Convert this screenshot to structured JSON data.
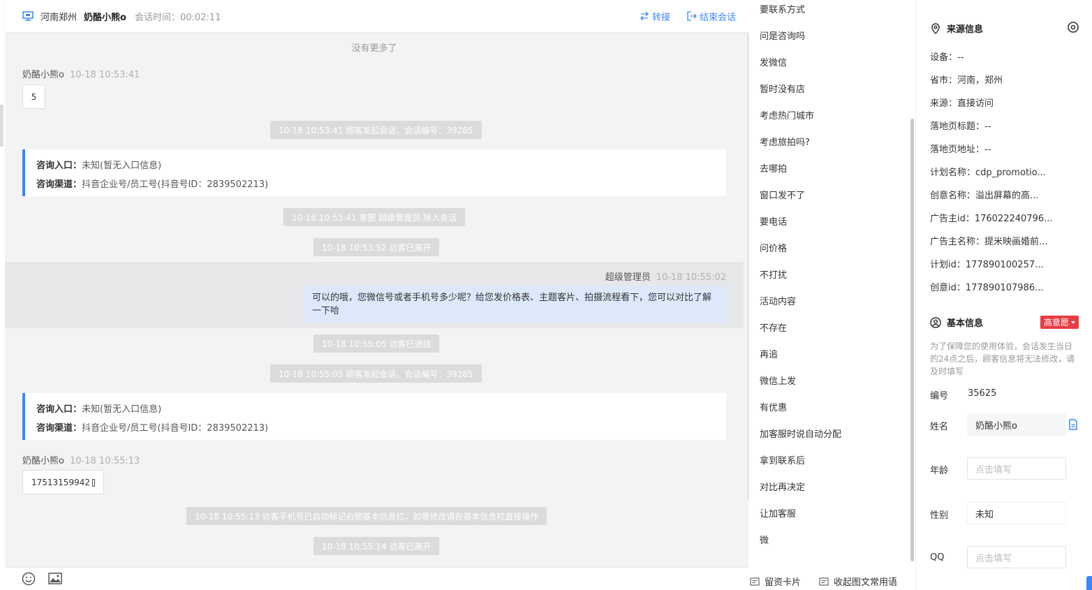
{
  "header": {
    "location": "河南郑州",
    "visitor_name": "奶酪小熊o",
    "session_time_label": "会话时间：",
    "session_time": "00:02:11",
    "transfer_label": "转接",
    "end_label": "结束会话"
  },
  "chat": {
    "no_more": "没有更多了",
    "msg1": {
      "sender": "奶酪小熊o",
      "time": "10-18 10:53:41",
      "text": "5"
    },
    "sys1": "10-18 10:53:41 顾客发起会话，会话编号：39285",
    "card1": {
      "entry_label": "咨询入口：",
      "entry_value": "未知(暂无入口信息)",
      "channel_label": "咨询渠道：",
      "channel_value": "抖音企业号/员工号(抖音号ID：2839502213)"
    },
    "sys2": "10-18 10:53:41 客服 超级管理员 接入会话",
    "sys3": "10-18 10:53:52 访客已离开",
    "agent_msg": {
      "sender": "超级管理员",
      "time": "10-18 10:55:02",
      "text": "可以的哦，您微信号或者手机号多少呢？给您发价格表、主题客片、拍摄流程看下，您可以对比了解一下哈"
    },
    "sys4": "10-18 10:55:05 访客已进线",
    "sys5": "10-18 10:55:05 顾客发起会话，会话编号：39285",
    "card2": {
      "entry_label": "咨询入口：",
      "entry_value": "未知(暂无入口信息)",
      "channel_label": "咨询渠道：",
      "channel_value": "抖音企业号/员工号(抖音号ID：2839502213)"
    },
    "msg2": {
      "sender": "奶酪小熊o",
      "time": "10-18 10:55:13",
      "text": "17513159942"
    },
    "sys6": "10-18 10:55:13 访客手机号已自动标记右侧基本信息栏，如需修改请在基本信息栏直接操作",
    "sys7": "10-18 10:55:14 访客已离开"
  },
  "phrases": {
    "items": [
      "要联系方式",
      "问是咨询吗",
      "发微信",
      "暂时没有店",
      "考虑热门城市",
      "考虑旅拍吗?",
      "去哪拍",
      "窗口发不了",
      "要电话",
      "问价格",
      "不打扰",
      "活动内容",
      "不存在",
      "再追",
      "微信上发",
      "有优惠",
      "加客服时说自动分配",
      "拿到联系后",
      "对比再决定",
      "让加客服",
      "微"
    ],
    "footer_card": "留资卡片",
    "footer_collapse": "收起图文常用语"
  },
  "source": {
    "title": "来源信息",
    "device": "设备：--",
    "province": "省市：河南，郑州",
    "origin": "来源：直接访问",
    "landing_title": "落地页标题：--",
    "landing_url": "落地页地址：--",
    "plan_name": "计划名称：cdp_promotio...",
    "creative_name": "创意名称：溢出屏幕的高...",
    "advertiser_id": "广告主id：176022240796...",
    "advertiser_name": "广告主名称：提米映画婚前...",
    "plan_id": "计划id：177890100257...",
    "creative_id": "创意id：177890107986..."
  },
  "basic": {
    "title": "基本信息",
    "intent_badge": "高意愿",
    "notice": "为了保障您的使用体验，会话发生当日的24点之后，顾客信息将无法修改，请及时填写",
    "id_label": "编号",
    "id_value": "35625",
    "name_label": "姓名",
    "name_value": "奶酪小熊o",
    "age_label": "年龄",
    "age_placeholder": "点击填写",
    "gender_label": "性别",
    "gender_value": "未知",
    "qq_label": "QQ",
    "qq_placeholder": "点击填写"
  },
  "colors": {
    "accent": "#3a86ff",
    "badge": "#e93c44",
    "agent_bubble": "#dde8fb",
    "system_pill": "#dadbdd"
  },
  "icons": [
    "monitor-icon",
    "transfer-icon",
    "exit-icon",
    "copy-icon",
    "emoji-icon",
    "image-icon",
    "card-icon",
    "collapse-icon",
    "location-pin-icon",
    "eye-icon",
    "user-circle-icon",
    "document-icon"
  ]
}
